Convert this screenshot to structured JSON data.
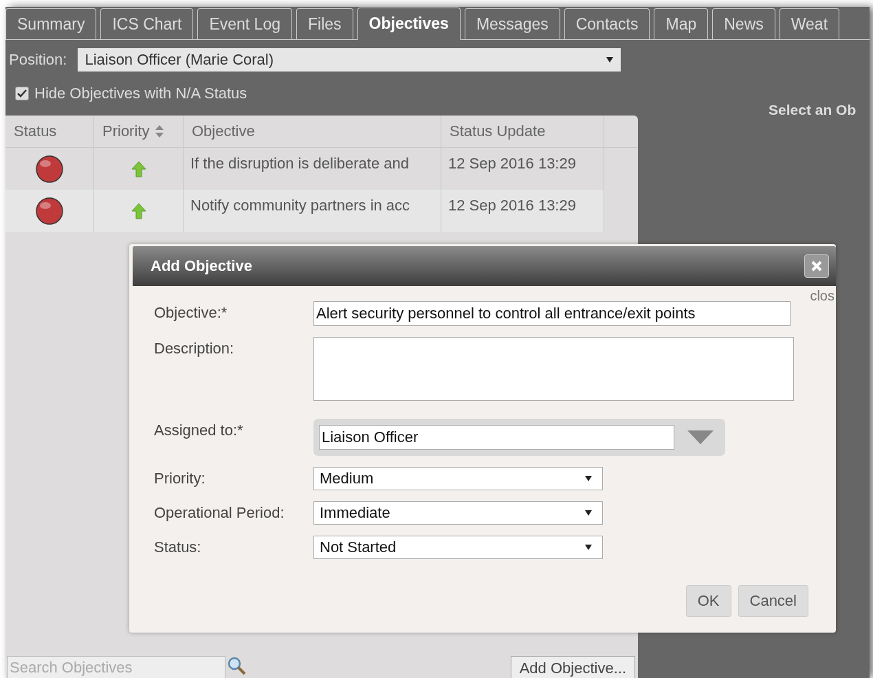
{
  "tabs": [
    {
      "label": "Summary",
      "selected": false
    },
    {
      "label": "ICS Chart",
      "selected": false
    },
    {
      "label": "Event Log",
      "selected": false
    },
    {
      "label": "Files",
      "selected": false
    },
    {
      "label": "Objectives",
      "selected": true
    },
    {
      "label": "Messages",
      "selected": false
    },
    {
      "label": "Contacts",
      "selected": false
    },
    {
      "label": "Map",
      "selected": false
    },
    {
      "label": "News",
      "selected": false
    },
    {
      "label": "Weat",
      "selected": false
    }
  ],
  "position": {
    "label": "Position:",
    "value": "Liaison Officer (Marie Coral)"
  },
  "hide_na": {
    "label": "Hide Objectives with N/A Status",
    "checked": true
  },
  "detail_hint": "Select an Ob",
  "table": {
    "columns": [
      {
        "label": "Status",
        "sortable": false
      },
      {
        "label": "Priority",
        "sortable": true
      },
      {
        "label": "Objective",
        "sortable": false
      },
      {
        "label": "Status Update",
        "sortable": false
      }
    ],
    "rows": [
      {
        "color": "#c0393b",
        "kind": "high",
        "objective": "If the disruption is deliberate and",
        "updated": "12 Sep 2016 13:29"
      },
      {
        "color": "#c0393b",
        "kind": "high",
        "objective": "Notify community partners in acc",
        "updated": "12 Sep 2016 13:29"
      }
    ]
  },
  "search": {
    "placeholder": "Search Objectives"
  },
  "add_button": "Add Objective...",
  "dialog": {
    "title": "Add Objective",
    "close_label": "clos",
    "fields": [
      {
        "kind": "text",
        "label": "Objective:*",
        "value": "Alert security personnel to control all entrance/exit points"
      },
      {
        "kind": "textarea",
        "label": "Description:"
      },
      {
        "kind": "combo",
        "label": "Assigned to:*",
        "value": "Liaison Officer"
      },
      {
        "kind": "select",
        "label": "Priority:",
        "value": "Medium"
      },
      {
        "kind": "select",
        "label": "Operational Period:",
        "value": "Immediate"
      },
      {
        "kind": "select",
        "label": "Status:",
        "value": "Not Started"
      }
    ],
    "buttons": [
      "OK",
      "Cancel"
    ]
  }
}
